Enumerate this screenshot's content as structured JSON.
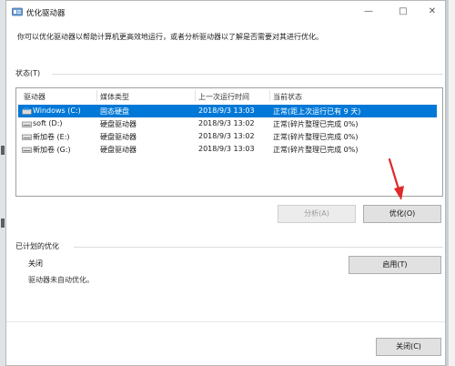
{
  "window": {
    "title": "优化驱动器",
    "description": "你可以优化驱动器以帮助计算机更高效地运行，或者分析驱动器以了解是否需要对其进行优化。",
    "controls": {
      "minimize": "—",
      "maximize": "□",
      "close": "✕"
    }
  },
  "status": {
    "label": "状态(T)",
    "columns": [
      "驱动器",
      "媒体类型",
      "上一次运行时间",
      "当前状态"
    ],
    "rows": [
      {
        "drive": "Windows (C:)",
        "media": "固态硬盘",
        "last_run": "2018/9/3 13:03",
        "status": "正常(距上次运行已有 9 天)",
        "selected": true
      },
      {
        "drive": "soft (D:)",
        "media": "硬盘驱动器",
        "last_run": "2018/9/3 13:02",
        "status": "正常(碎片整理已完成 0%)",
        "selected": false
      },
      {
        "drive": "新加卷 (E:)",
        "media": "硬盘驱动器",
        "last_run": "2018/9/3 13:02",
        "status": "正常(碎片整理已完成 0%)",
        "selected": false
      },
      {
        "drive": "新加卷 (G:)",
        "media": "硬盘驱动器",
        "last_run": "2018/9/3 13:03",
        "status": "正常(碎片整理已完成 0%)",
        "selected": false
      }
    ]
  },
  "buttons": {
    "analyze": "分析(A)",
    "optimize": "优化(O)",
    "enable": "启用(T)",
    "close": "关闭(C)"
  },
  "scheduled": {
    "label": "已计划的优化",
    "state": "关闭",
    "description": "驱动器未自动优化。"
  },
  "colors": {
    "selection": "#0078d7",
    "annotation_arrow": "#e02a2a"
  }
}
